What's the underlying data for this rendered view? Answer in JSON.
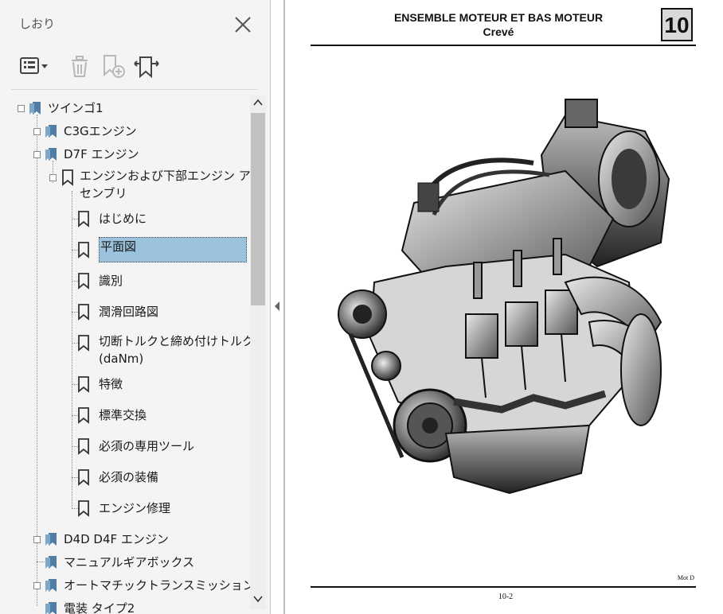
{
  "sidebar": {
    "title": "しおり",
    "toolbar": {
      "options_icon": "list-options-icon",
      "delete_icon": "trash-icon",
      "new_bookmark_icon": "add-bookmark-icon",
      "expand_icon": "bookmark-expand-icon"
    },
    "tree": [
      {
        "label": "ツインゴ1",
        "level": 0
      },
      {
        "label": "C3Gエンジン",
        "level": 1
      },
      {
        "label": "D7F エンジン",
        "level": 1
      },
      {
        "label": "エンジンおよび下部エンジン ア",
        "label2": "センブリ",
        "level": 2
      },
      {
        "label": "はじめに",
        "level": 3
      },
      {
        "label": "平面図",
        "level": 3,
        "selected": true
      },
      {
        "label": "識別",
        "level": 3
      },
      {
        "label": "潤滑回路図",
        "level": 3
      },
      {
        "label": "切断トルクと締め付けトルク",
        "label2": "(daNm)",
        "level": 3
      },
      {
        "label": "特徴",
        "level": 3
      },
      {
        "label": "標準交換",
        "level": 3
      },
      {
        "label": "必須の専用ツール",
        "level": 3
      },
      {
        "label": "必須の装備",
        "level": 3
      },
      {
        "label": "エンジン修理",
        "level": 3
      },
      {
        "label": "D4D D4F エンジン",
        "level": 1
      },
      {
        "label": "マニュアルギアボックス",
        "level": 1
      },
      {
        "label": "オートマチックトランスミッション",
        "level": 1
      },
      {
        "label": "電装 タイプ2",
        "level": 1
      }
    ]
  },
  "document": {
    "title_line1": "ENSEMBLE MOTEUR ET BAS MOTEUR",
    "title_line2": "Crevé",
    "chapter": "10",
    "footer_code": "Mot D",
    "page_number": "10-2"
  },
  "colors": {
    "selection_bg": "#9cc3de",
    "selection_border": "#4a4a4a",
    "bookmark_icon": "#4f7da3"
  }
}
